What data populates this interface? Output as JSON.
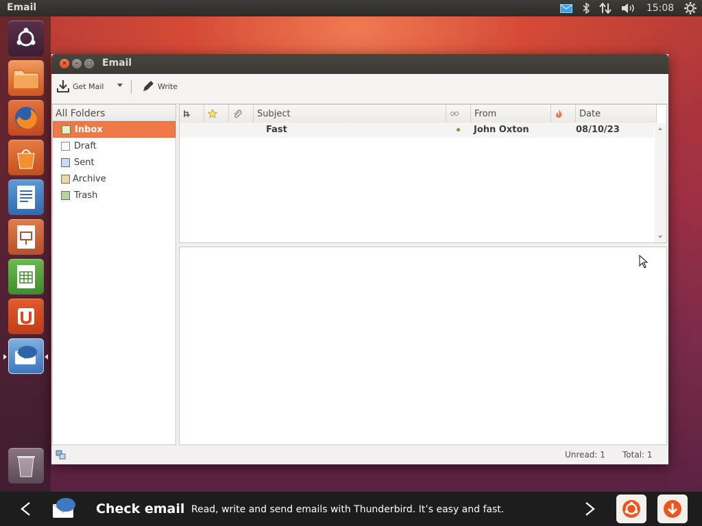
{
  "topbar": {
    "app_title": "Email",
    "clock": "15:08",
    "icons": [
      "mail-indicator-icon",
      "bluetooth-icon",
      "network-icon",
      "volume-icon",
      "gear-icon"
    ]
  },
  "launcher": {
    "apps": [
      "ubuntu-dash",
      "files",
      "firefox",
      "software-center",
      "writer",
      "impress",
      "calc",
      "ubuntu-one",
      "thunderbird",
      "trash"
    ]
  },
  "window": {
    "title": "Email"
  },
  "toolbar": {
    "get_mail": "Get Mail",
    "write": "Write"
  },
  "folders": {
    "header": "All Folders",
    "items": [
      {
        "label": "Inbox",
        "selected": true
      },
      {
        "label": "Draft"
      },
      {
        "label": "Sent"
      },
      {
        "label": "Archive"
      },
      {
        "label": "Trash"
      }
    ]
  },
  "threads": {
    "columns": {
      "subject": "Subject",
      "from": "From",
      "date": "Date"
    },
    "rows": [
      {
        "subject": "Fast",
        "from": "John Oxton",
        "date": "08/10/23"
      }
    ]
  },
  "status": {
    "unread": "Unread: 1",
    "total": "Total: 1"
  },
  "bottom": {
    "title": "Check email",
    "desc": "Read, write and send emails with Thunderbird. It’s easy and fast."
  },
  "colors": {
    "accent": "#f07746",
    "panel": "#3c3b37"
  }
}
